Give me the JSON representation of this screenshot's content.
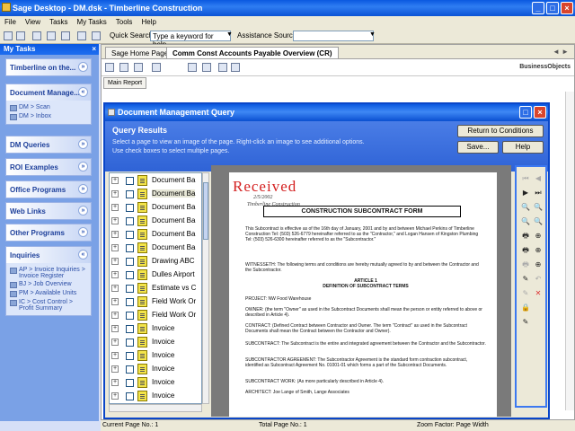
{
  "window": {
    "title": "Sage Desktop - DM.dsk - Timberline Construction",
    "buttons": [
      "_",
      "□",
      "×"
    ]
  },
  "menu": [
    "File",
    "View",
    "Tasks",
    "My Tasks",
    "Tools",
    "Help"
  ],
  "toolbar": {
    "quick_search_label": "Quick Search",
    "quick_search_value": "Type a keyword for help",
    "assistance_label": "Assistance Source"
  },
  "sidebar": {
    "header": "My Tasks",
    "close": "×",
    "panels": [
      {
        "title": "Timberline on the...",
        "items": []
      },
      {
        "title": "Document Manage...",
        "items": [
          "DM > Scan",
          "DM > Inbox"
        ]
      },
      {
        "title": "DM Queries",
        "items": []
      },
      {
        "title": "ROI Examples",
        "items": []
      },
      {
        "title": "Office Programs",
        "items": []
      },
      {
        "title": "Web Links",
        "items": []
      },
      {
        "title": "Other Programs",
        "items": []
      },
      {
        "title": "Inquiries",
        "items": [
          "AP > Invoice Inquiries > Invoice Register",
          "BJ > Job Overview",
          "PM > Available Units",
          "IC > Cost Control > Profit Summary"
        ]
      }
    ]
  },
  "main": {
    "tabs": [
      "Sage Home Page",
      "Comm Const Accounts Payable Overview (CR)"
    ],
    "tab_nav": "◄ ►",
    "subtab": "Main Report",
    "logo": "BusinessObjects"
  },
  "status": {
    "current_page": "Current Page No.: 1",
    "total_page": "Total Page No.: 1",
    "zoom": "Zoom Factor: Page Width"
  },
  "dialog": {
    "title": "Document Management Query",
    "heading": "Query Results",
    "instructions": [
      "Select a page to view an image of the page. Right-click an image to see additional options.",
      "Use check boxes to select multiple pages."
    ],
    "return_button": "Return to Conditions",
    "save_button": "Save...",
    "help_button": "Help"
  },
  "files": [
    "Document Ba",
    "Document Ba",
    "Document Ba",
    "Document Ba",
    "Document Ba",
    "Document Ba",
    "Drawing ABC",
    "Dulles Airport",
    "Estimate vs C",
    "Field Work Or",
    "Field Work Or",
    "Invoice",
    "Invoice",
    "Invoice",
    "Invoice",
    "Invoice",
    "Invoice",
    "Invoice"
  ],
  "document": {
    "stamp": "Received",
    "stamp_date": "2/5/2002",
    "stamp_sig": "Timberline Construction",
    "title": "CONSTRUCTION SUBCONTRACT FORM",
    "intro": "This Subcontract is effective as of the 16th day of January, 2001 and by and between Michael Perkins of Timberline Construction Tel: (503) 526-6779 hereinafter referred to as the \"Contractor,\" and Logan Hansen of Kingston Plumbing Tel: (503) 526-6300 hereinafter referred to as the \"Subcontractor.\"",
    "witnesseth": "WITNESSETH: The following terms and conditions are hereby mutually agreed to by and between the Contractor and the Subcontractor.",
    "article": "ARTICLE 1",
    "article_title": "DEFINITION OF SUBCONTRACT TERMS",
    "project": "PROJECT: NW Food Warehouse",
    "owner": "OWNER: (the term \"Owner\" as used in the Subcontract Documents shall mean the person or entity referred to above or described in Article 4).",
    "contract": "CONTRACT: (Defined Contract between Contractor and Owner. The term \"Contract\" as used in the Subcontract Documents shall mean the Contract between the Contractor and Owner).",
    "subcontract": "SUBCONTRACT: The Subcontract is the entire and integrated agreement between the Contractor and the Subcontractor.",
    "agreement": "SUBCONTRACTOR AGREEMENT: The Subcontractor Agreement is the standard form contraction subcontract, identified as Subcontract Agreement No. 01001-01 which forms a part of the Subcontract Documents.",
    "work": "SUBCONTRACT WORK: (As more particularly described in Article 4).",
    "architect": "ARCHITECT: Joe Lange of Smith, Lange Associates"
  },
  "tools": [
    "⏮",
    "◀",
    "▶",
    "⏭",
    "🔍",
    "🔍",
    "🔍",
    "🔍",
    "🖶",
    "⊕",
    "🖶",
    "⊕",
    "🖶",
    "⊕",
    "✎",
    "↶",
    "✎",
    "✕",
    "🔒",
    "✎"
  ]
}
